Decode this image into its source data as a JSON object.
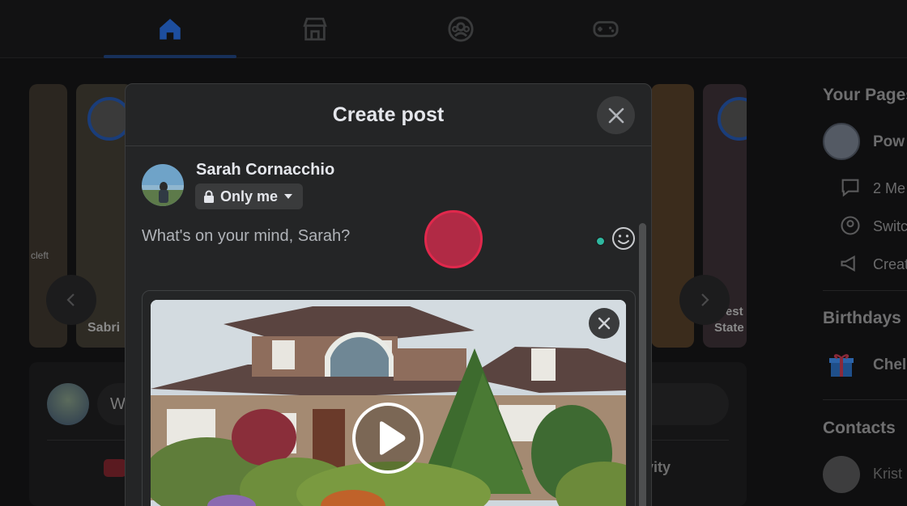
{
  "nav": {
    "tabs": [
      {
        "name": "home",
        "icon": "home-icon",
        "active": true
      },
      {
        "name": "marketplace",
        "icon": "marketplace-icon",
        "active": false
      },
      {
        "name": "groups",
        "icon": "groups-icon",
        "active": false
      },
      {
        "name": "gaming",
        "icon": "gaming-icon",
        "active": false
      }
    ]
  },
  "stories": {
    "items": [
      {
        "name": "Sabri"
      },
      {
        "name": "West\nState"
      }
    ],
    "story_text_snippet": "cleft"
  },
  "composer": {
    "placeholder_partial": "W",
    "activity_label": "tivity"
  },
  "sidebar": {
    "your_pages_heading": "Your Pages",
    "page_name": "Pow",
    "messages_label": "2 Me",
    "switch_label": "Switc",
    "create_label": "Creat",
    "birthdays_heading": "Birthdays",
    "birthday_name": "Chel",
    "contacts_heading": "Contacts",
    "contact_name": "Krist"
  },
  "modal": {
    "title": "Create post",
    "user_name": "Sarah Cornacchio",
    "audience_label": "Only me",
    "post_placeholder": "What's on your mind, Sarah?"
  },
  "colors": {
    "accent_blue": "#2d88ff",
    "record_red": "#e1284c",
    "status_green": "#2fb8a0"
  }
}
